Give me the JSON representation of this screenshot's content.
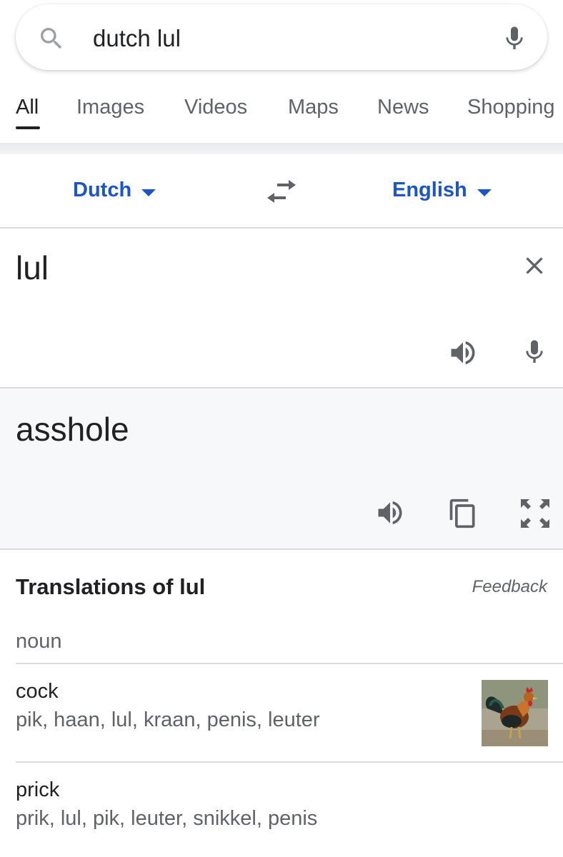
{
  "search": {
    "query": "dutch lul"
  },
  "tabs": [
    {
      "label": "All",
      "active": true
    },
    {
      "label": "Images"
    },
    {
      "label": "Videos"
    },
    {
      "label": "Maps"
    },
    {
      "label": "News"
    },
    {
      "label": "Shopping"
    }
  ],
  "translator": {
    "source_lang": "Dutch",
    "target_lang": "English",
    "source_text": "lul",
    "target_text": "asshole"
  },
  "translations": {
    "title": "Translations of lul",
    "feedback": "Feedback",
    "part_of_speech": "noun",
    "entries": [
      {
        "word": "cock",
        "synonyms": "pik, haan, lul, kraan, penis, leuter"
      },
      {
        "word": "prick",
        "synonyms": "prik, lul, pik, leuter, snikkel, penis"
      }
    ]
  },
  "colors": {
    "link_blue": "#1a56c8",
    "icon_gray": "#5f6368",
    "target_bg": "#f7f8fa"
  }
}
